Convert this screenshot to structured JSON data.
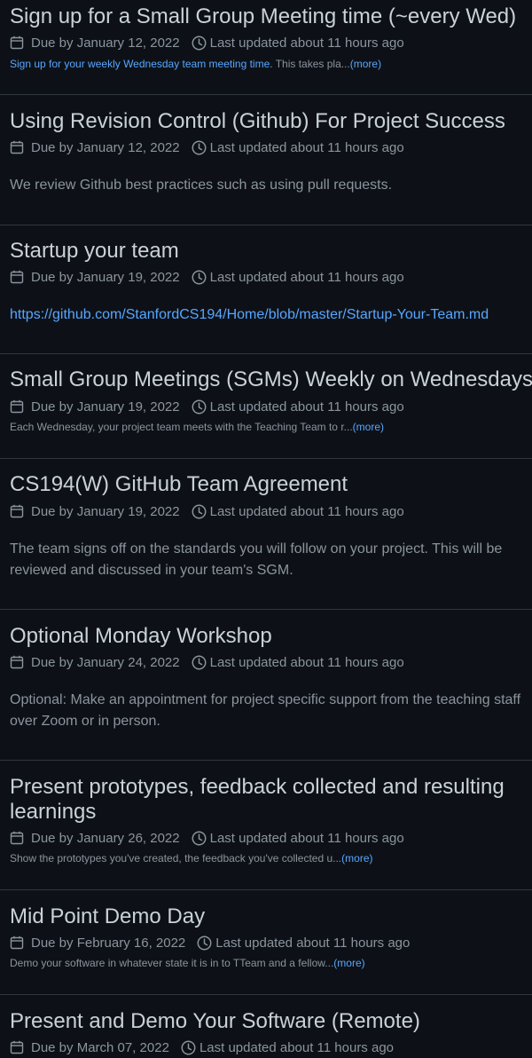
{
  "milestones": [
    {
      "title": "Sign up for a Small Group Meeting time (~every Wed)",
      "due": "Due by January 12, 2022",
      "updated": "Last updated about 11 hours ago",
      "desc_link": "Sign up for your weekly Wednesday team meeting time.",
      "desc_text": " This takes pla...",
      "more": "(more)"
    },
    {
      "title": "Using Revision Control (Github) For Project Success",
      "due": "Due by January 12, 2022",
      "updated": "Last updated about 11 hours ago",
      "desc": "We review Github best practices such as using pull requests."
    },
    {
      "title": "Startup your team",
      "due": "Due by January 19, 2022",
      "updated": "Last updated about 11 hours ago",
      "link": "https://github.com/StanfordCS194/Home/blob/master/Startup-Your-Team.md"
    },
    {
      "title": "Small Group Meetings (SGMs) Weekly on Wednesdays",
      "due": "Due by January 19, 2022",
      "updated": "Last updated about 11 hours ago",
      "desc_text": "Each Wednesday, your project team meets with the Teaching Team to r...",
      "more": "(more)"
    },
    {
      "title": "CS194(W) GitHub Team Agreement",
      "due": "Due by January 19, 2022",
      "updated": "Last updated about 11 hours ago",
      "desc_line1": "The team signs off on the standards you will follow on your project. This will be",
      "desc_line2": "reviewed and discussed in your team's SGM."
    },
    {
      "title": "Optional Monday Workshop",
      "due": "Due by January 24, 2022",
      "updated": "Last updated about 11 hours ago",
      "desc_line1": "Optional: Make an appointment for project specific support from the teaching staff",
      "desc_line2": "over Zoom or in person."
    },
    {
      "title": "Present prototypes, feedback collected and resulting learnings",
      "due": "Due by January 26, 2022",
      "updated": "Last updated about 11 hours ago",
      "desc_text": "Show the prototypes you've created, the feedback you've collected u...",
      "more": "(more)"
    },
    {
      "title": "Mid Point Demo Day",
      "due": "Due by February 16, 2022",
      "updated": "Last updated about 11 hours ago",
      "desc_text": "Demo your software in whatever state it is in to TTeam and a fellow...",
      "more": "(more)"
    },
    {
      "title": "Present and Demo Your Software (Remote)",
      "due": "Due by March 07, 2022",
      "updated": "Last updated about 11 hours ago"
    }
  ],
  "icons": {
    "calendar": "calendar-icon",
    "clock": "clock-icon"
  },
  "colors": {
    "background": "#0d1117",
    "title": "#c9d1d9",
    "muted": "#8b949e",
    "link": "#58a6ff",
    "border": "#30363d"
  }
}
